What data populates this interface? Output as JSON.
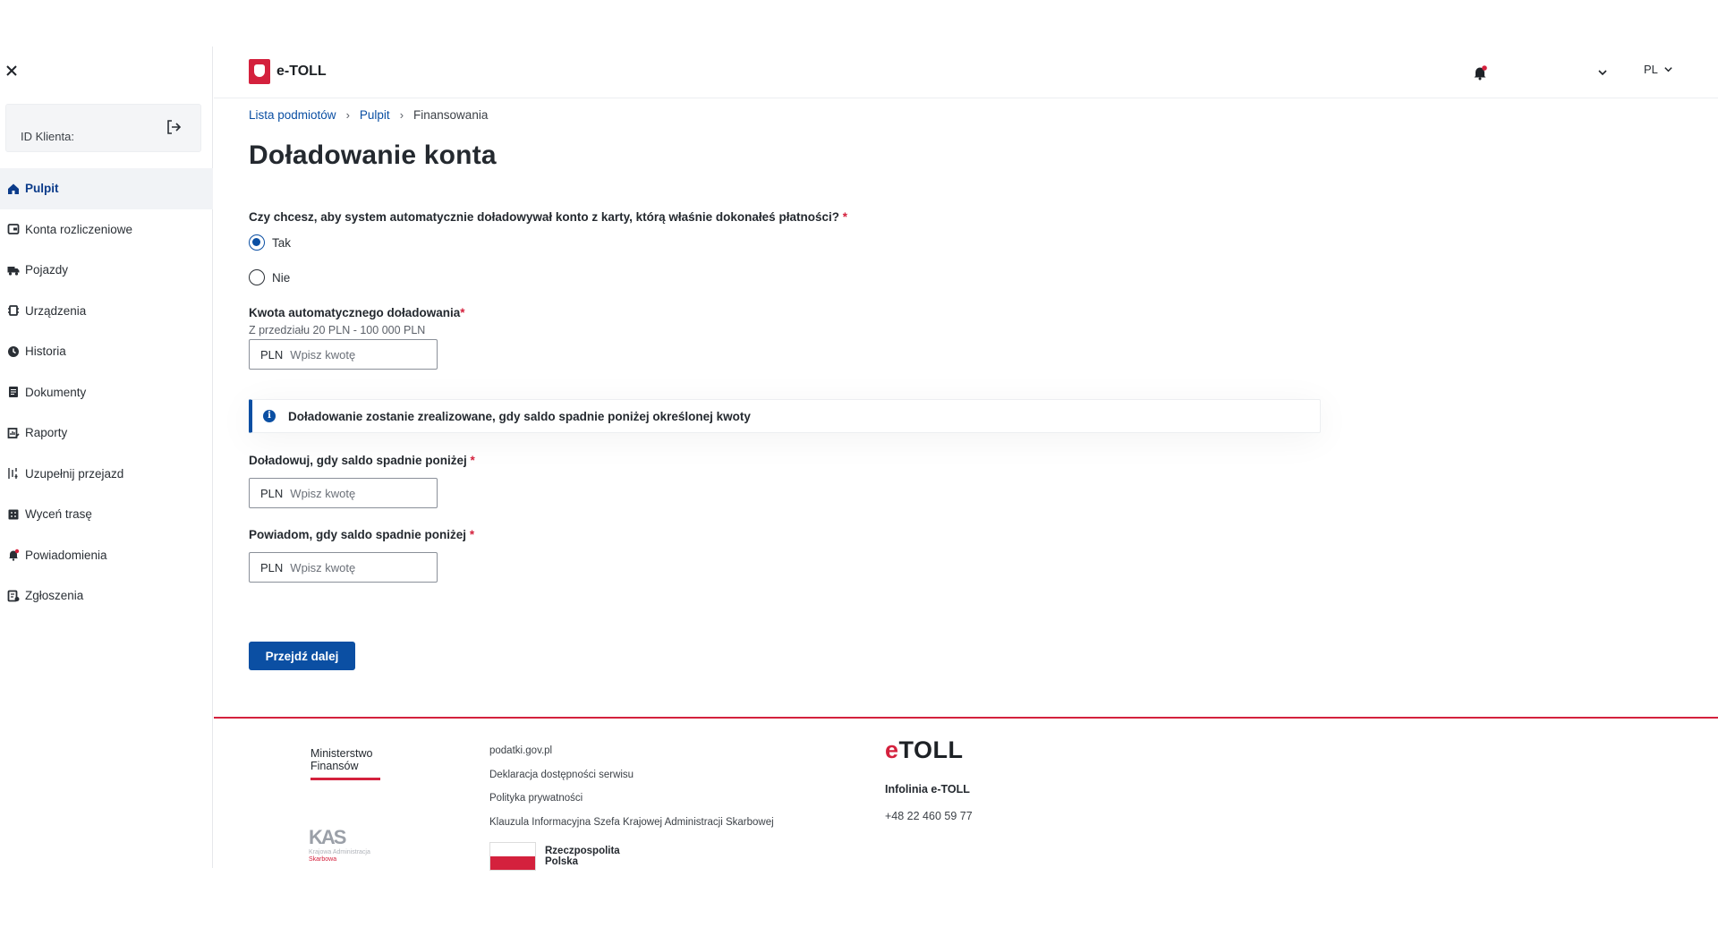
{
  "app": {
    "name": "e-TOLL",
    "language": "PL",
    "accent_color": "#0b4fa3",
    "brand_red": "#d4213d"
  },
  "sidebar": {
    "client_id_label": "ID Klienta:",
    "items": [
      {
        "label": "Pulpit",
        "icon": "home-icon",
        "active": true
      },
      {
        "label": "Konta rozliczeniowe",
        "icon": "wallet-icon",
        "active": false
      },
      {
        "label": "Pojazdy",
        "icon": "truck-icon",
        "active": false
      },
      {
        "label": "Urządzenia",
        "icon": "device-icon",
        "active": false
      },
      {
        "label": "Historia",
        "icon": "clock-icon",
        "active": false
      },
      {
        "label": "Dokumenty",
        "icon": "document-icon",
        "active": false
      },
      {
        "label": "Raporty",
        "icon": "report-icon",
        "active": false
      },
      {
        "label": "Uzupełnij przejazd",
        "icon": "route-edit-icon",
        "active": false
      },
      {
        "label": "Wyceń trasę",
        "icon": "calculator-icon",
        "active": false
      },
      {
        "label": "Powiadomienia",
        "icon": "bell-icon",
        "active": false
      },
      {
        "label": "Zgłoszenia",
        "icon": "ticket-icon",
        "active": false
      }
    ]
  },
  "breadcrumb": {
    "items": [
      "Lista podmiotów",
      "Pulpit"
    ],
    "current": "Finansowania"
  },
  "page": {
    "title": "Doładowanie konta",
    "question": "Czy chcesz, aby system automatycznie doładowywał konto z karty, którą właśnie dokonałeś płatności?",
    "required_mark": "*",
    "options": [
      {
        "label": "Tak",
        "selected": true
      },
      {
        "label": "Nie",
        "selected": false
      }
    ],
    "amount_field": {
      "label": "Kwota automatycznego doładowania",
      "hint": "Z przedziału 20 PLN - 100 000 PLN",
      "currency": "PLN",
      "placeholder": "Wpisz kwotę",
      "value": ""
    },
    "info_message": "Doładowanie zostanie zrealizowane, gdy saldo spadnie poniżej określonej kwoty",
    "threshold_field": {
      "label": "Doładowuj, gdy saldo spadnie poniżej",
      "currency": "PLN",
      "placeholder": "Wpisz kwotę",
      "value": ""
    },
    "notify_field": {
      "label": "Powiadom, gdy saldo spadnie poniżej",
      "currency": "PLN",
      "placeholder": "Wpisz kwotę",
      "value": ""
    },
    "submit_label": "Przejdź dalej"
  },
  "footer": {
    "ministry": [
      "Ministerstwo",
      "Finansów"
    ],
    "kas_mark": "KAS",
    "kas_text": [
      "Krajowa Administracja",
      "Skarbowa"
    ],
    "links": [
      "podatki.gov.pl",
      "Deklaracja dostępności serwisu",
      "Polityka prywatności",
      "Klauzula Informacyjna Szefa Krajowej Administracji Skarbowej"
    ],
    "rp_text": [
      "Rzeczpospolita",
      "Polska"
    ],
    "etoll_logo_e": "e",
    "etoll_logo_rest": "TOLL",
    "hotline_label": "Infolinia e-TOLL",
    "hotline_phone": "+48 22 460 59 77"
  }
}
